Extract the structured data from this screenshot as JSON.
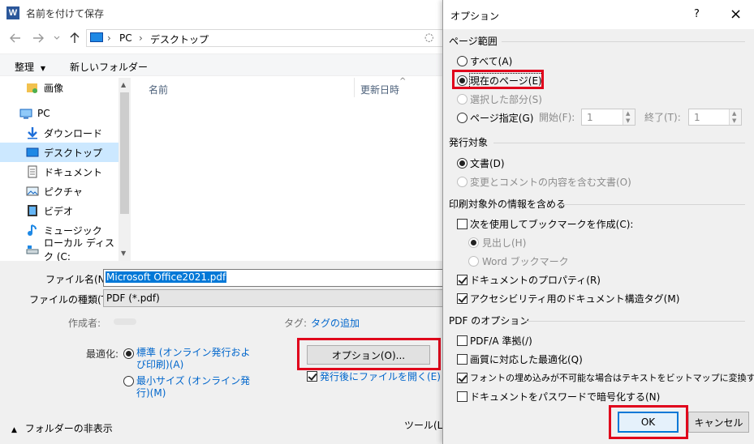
{
  "save_dialog": {
    "title": "名前を付けて保存",
    "app_icon_letter": "W",
    "address": {
      "segments": [
        "PC",
        "デスクトップ"
      ]
    },
    "commands": {
      "organize": "整理",
      "new_folder": "新しいフォルダー"
    },
    "nav": [
      {
        "label": "画像",
        "icon": "pictures-folder-icon"
      },
      {
        "label": "PC",
        "icon": "pc-icon"
      },
      {
        "label": "ダウンロード",
        "icon": "download-icon"
      },
      {
        "label": "デスクトップ",
        "icon": "desktop-icon",
        "selected": true
      },
      {
        "label": "ドキュメント",
        "icon": "document-icon"
      },
      {
        "label": "ピクチャ",
        "icon": "picture-icon"
      },
      {
        "label": "ビデオ",
        "icon": "video-icon"
      },
      {
        "label": "ミュージック",
        "icon": "music-icon"
      },
      {
        "label": "ローカル ディスク (C:",
        "icon": "disk-icon"
      }
    ],
    "columns": {
      "name": "名前",
      "modified": "更新日時"
    },
    "file_name_label": "ファイル名(N):",
    "file_name_value": "Microsoft Office2021.pdf",
    "file_type_label": "ファイルの種類(T):",
    "file_type_value": "PDF (*.pdf)",
    "author_label": "作成者:",
    "tags_label": "タグ:",
    "tags_link": "タグの追加",
    "optimize_label": "最適化:",
    "optimize_standard_line1": "標準 (オンライン発行およ",
    "optimize_standard_line2": "び印刷)(A)",
    "optimize_min_line1": "最小サイズ (オンライン発",
    "optimize_min_line2": "行)(M)",
    "options_button": "オプション(O)...",
    "open_after_publish": "発行後にファイルを開く(E)",
    "hide_folders": "フォルダーの非表示",
    "tools": "ツール(L)"
  },
  "options_dialog": {
    "title": "オプション",
    "help": "?",
    "close": "×",
    "page_range": {
      "title": "ページ範囲",
      "all": "すべて(A)",
      "current": "現在のページ(E)",
      "selection": "選択した部分(S)",
      "pages": "ページ指定(G)",
      "start_label": "開始(F):",
      "start_value": "1",
      "end_label": "終了(T):",
      "end_value": "1"
    },
    "publish_what": {
      "title": "発行対象",
      "document": "文書(D)",
      "markup": "変更とコメントの内容を含む文書(O)"
    },
    "non_printing": {
      "title": "印刷対象外の情報を含める",
      "bookmarks": "次を使用してブックマークを作成(C):",
      "headings": "見出し(H)",
      "word_bookmarks": "Word ブックマーク",
      "properties": "ドキュメントのプロパティ(R)",
      "structure_tags": "アクセシビリティ用のドキュメント構造タグ(M)"
    },
    "pdf_options": {
      "title": "PDF のオプション",
      "pdfa": "PDF/A 準拠(/)",
      "image_quality": "画質に対応した最適化(Q)",
      "bitmap_text": "フォントの埋め込みが不可能な場合はテキストをビットマップに変換する(X)",
      "encrypt": "ドキュメントをパスワードで暗号化する(N)"
    },
    "ok": "OK",
    "cancel": "キャンセル"
  }
}
